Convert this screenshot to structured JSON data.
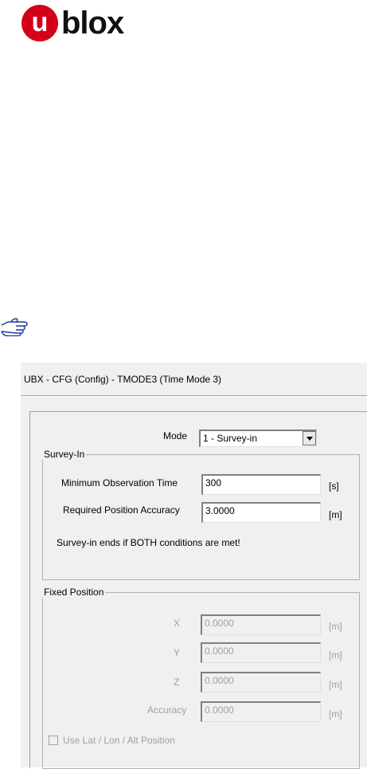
{
  "logo": {
    "letter": "u",
    "text": "blox"
  },
  "dialog": {
    "title": "UBX - CFG (Config) - TMODE3 (Time Mode 3)",
    "mode": {
      "label": "Mode",
      "value": "1 - Survey-in"
    },
    "survey_in": {
      "title": "Survey-In",
      "min_obs_label": "Minimum Observation Time",
      "min_obs_value": "300",
      "min_obs_unit": "[s]",
      "req_acc_label": "Required Position Accuracy",
      "req_acc_value": "3.0000",
      "req_acc_unit": "[m]",
      "note": "Survey-in ends if BOTH conditions are met!"
    },
    "fixed_position": {
      "title": "Fixed Position",
      "x_label": "X",
      "x_value": "0.0000",
      "x_unit": "[m]",
      "y_label": "Y",
      "y_value": "0.0000",
      "y_unit": "[m]",
      "z_label": "Z",
      "z_value": "0.0000",
      "z_unit": "[m]",
      "acc_label": "Accuracy",
      "acc_value": "0.0000",
      "acc_unit": "[m]",
      "use_lla_label": "Use Lat / Lon / Alt Position"
    }
  }
}
